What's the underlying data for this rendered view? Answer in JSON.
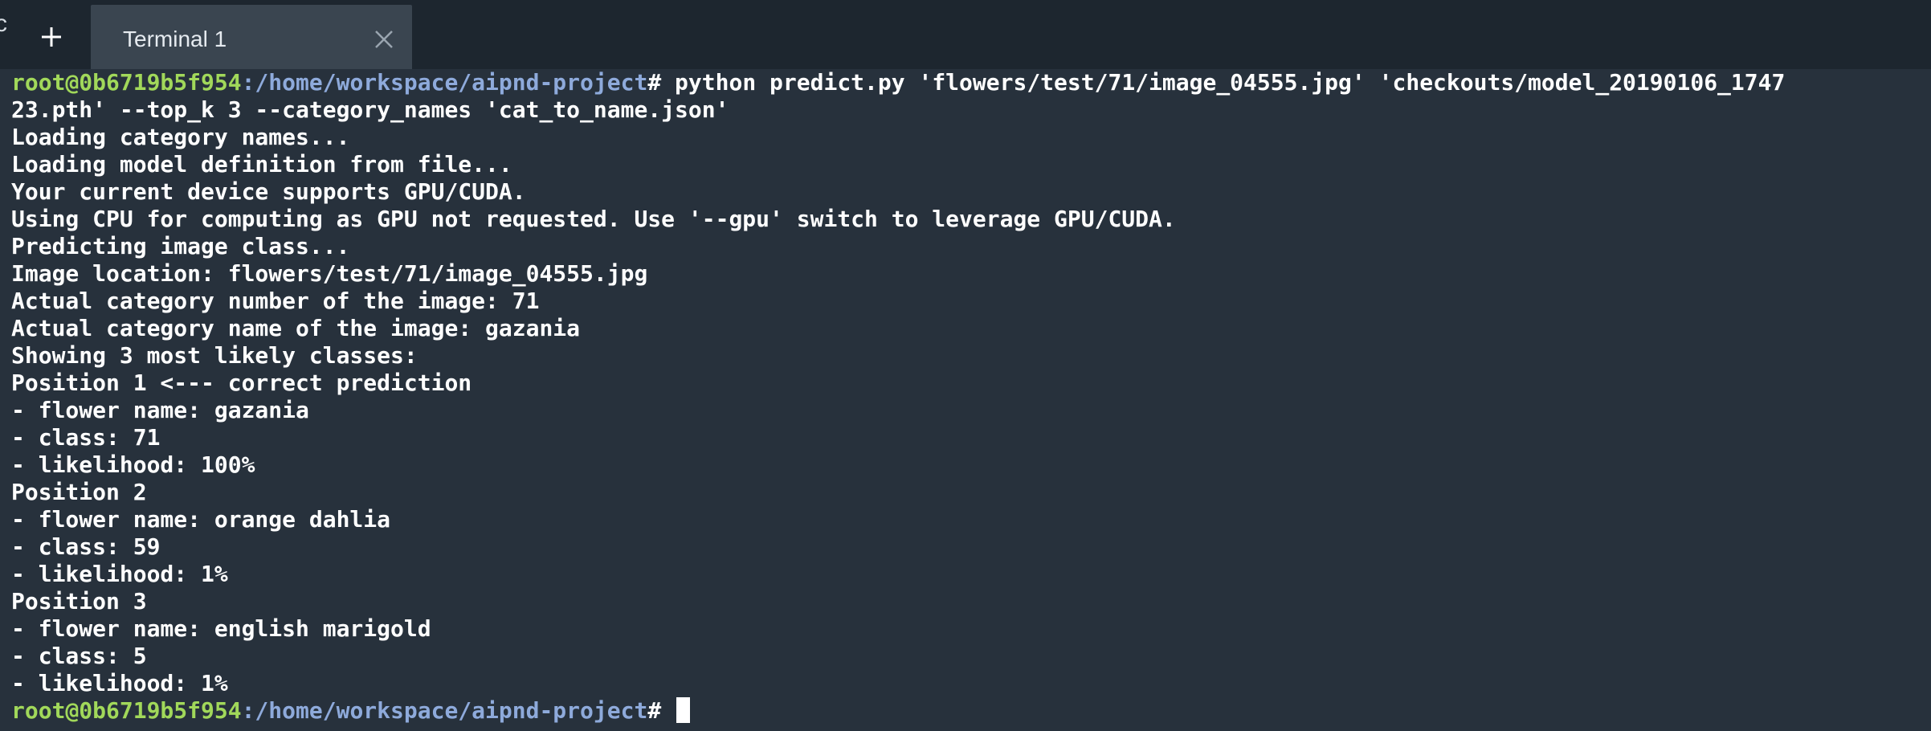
{
  "tabbar": {
    "edge_glyph": "cl",
    "new_tab_icon": "plus-icon",
    "tabs": [
      {
        "label": "Terminal 1",
        "close_icon": "close-icon"
      }
    ]
  },
  "terminal": {
    "prompt_user": "root@0b6719b5f954",
    "prompt_path": ":/home/workspace/aipnd-project",
    "prompt_symbol": "#",
    "command_line_1": " python predict.py 'flowers/test/71/image_04555.jpg' 'checkouts/model_20190106_1747",
    "command_line_2": "23.pth' --top_k 3 --category_names 'cat_to_name.json'",
    "output": [
      "Loading category names...",
      "Loading model definition from file...",
      "Your current device supports GPU/CUDA.",
      "Using CPU for computing as GPU not requested. Use '--gpu' switch to leverage GPU/CUDA.",
      "Predicting image class...",
      "Image location: flowers/test/71/image_04555.jpg",
      "Actual category number of the image: 71",
      "Actual category name of the image: gazania",
      "Showing 3 most likely classes:",
      "Position 1 <--- correct prediction",
      "- flower name: gazania",
      "- class: 71",
      "- likelihood: 100%",
      "Position 2",
      "- flower name: orange dahlia",
      "- class: 59",
      "- likelihood: 1%",
      "Position 3",
      "- flower name: english marigold",
      "- class: 5",
      "- likelihood: 1%"
    ],
    "final_prompt_user": "root@0b6719b5f954",
    "final_prompt_path": ":/home/workspace/aipnd-project",
    "final_prompt_symbol": "# "
  },
  "colors": {
    "background": "#27313c",
    "tabbar": "#1d262f",
    "active_tab": "#3a4550",
    "prompt_user": "#a1d85a",
    "prompt_path": "#8eaadb",
    "text": "#ffffff"
  }
}
